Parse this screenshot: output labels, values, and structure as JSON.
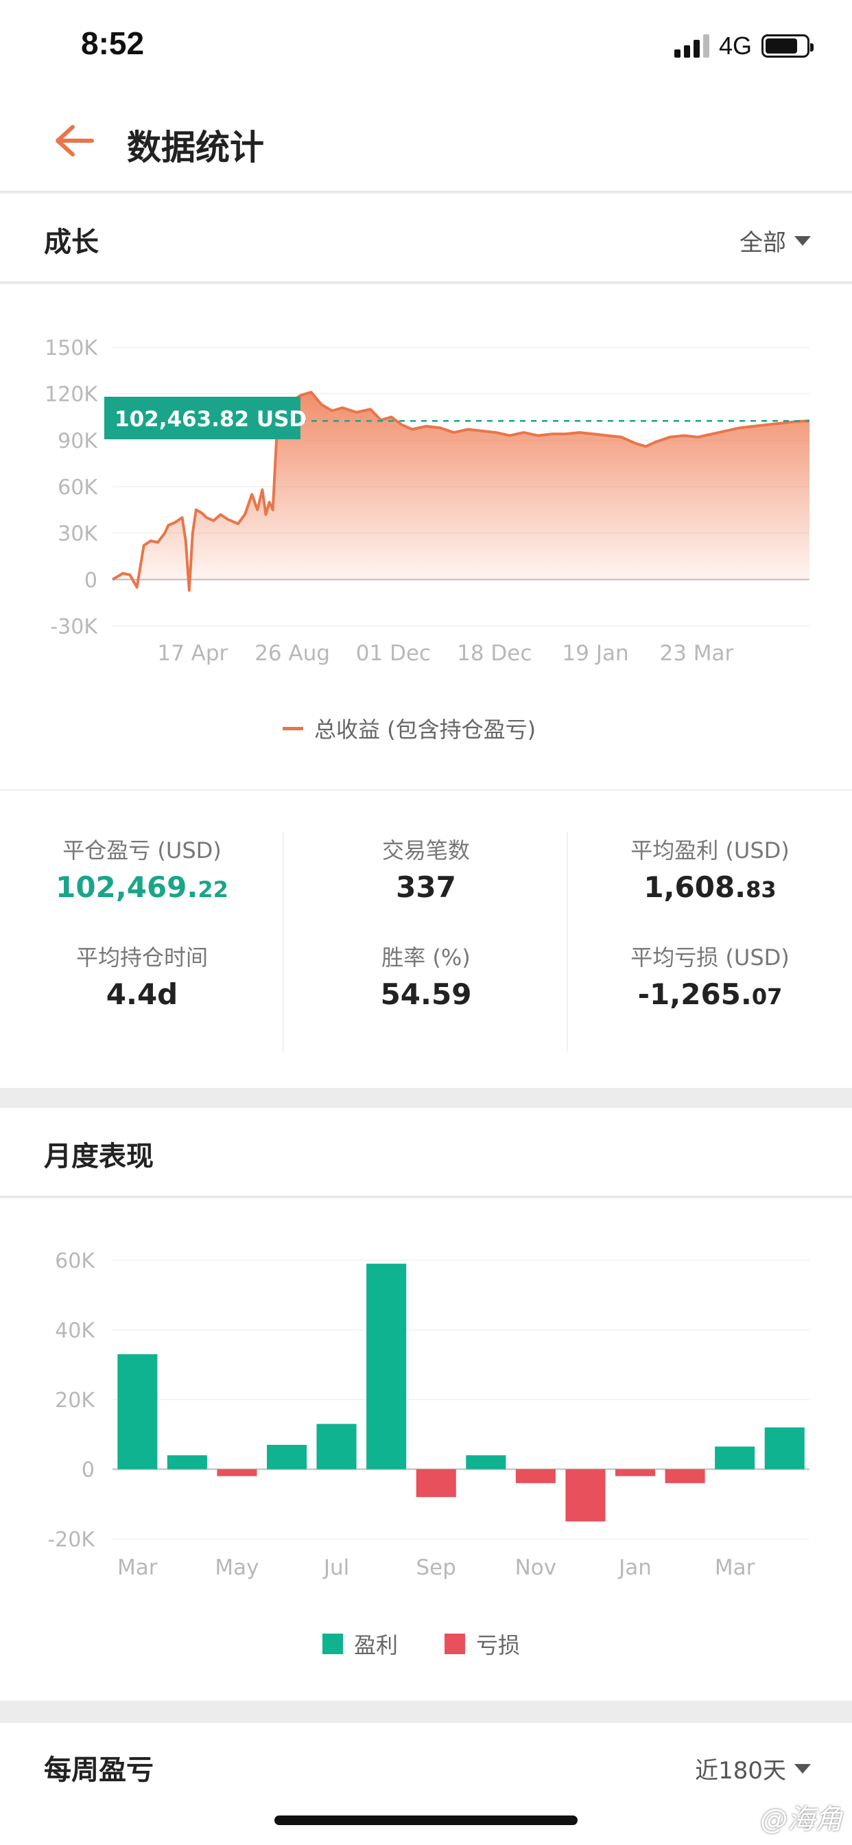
{
  "status": {
    "time": "8:52",
    "network": "4G"
  },
  "header": {
    "title": "数据统计"
  },
  "growth": {
    "title": "成长",
    "filter": "全部",
    "highlight": "102,463.82 USD",
    "legend": "总收益 (包含持仓盈亏)",
    "y_ticks": [
      "150K",
      "120K",
      "90K",
      "60K",
      "30K",
      "0",
      "-30K"
    ],
    "x_ticks": [
      "17 Apr",
      "26 Aug",
      "01 Dec",
      "18 Dec",
      "19 Jan",
      "23 Mar"
    ]
  },
  "stats": {
    "closed_pnl_label": "平仓盈亏 (USD)",
    "closed_pnl_int": "102,469.",
    "closed_pnl_dec": "22",
    "trades_label": "交易笔数",
    "trades_value": "337",
    "avg_profit_label": "平均盈利 (USD)",
    "avg_profit_int": "1,608.",
    "avg_profit_dec": "83",
    "avg_hold_label": "平均持仓时间",
    "avg_hold_value": "4.4d",
    "winrate_label": "胜率 (%)",
    "winrate_value": "54.59",
    "avg_loss_label": "平均亏损 (USD)",
    "avg_loss_int": "-1,265.",
    "avg_loss_dec": "07"
  },
  "monthly": {
    "title": "月度表现",
    "y_ticks": [
      "60K",
      "40K",
      "20K",
      "0",
      "-20K"
    ],
    "x_ticks": [
      "Mar",
      "May",
      "Jul",
      "Sep",
      "Nov",
      "Jan",
      "Mar"
    ],
    "legend_profit": "盈利",
    "legend_loss": "亏损"
  },
  "weekly": {
    "title": "每周盈亏",
    "filter": "近180天"
  },
  "watermark": "@海角",
  "colors": {
    "accent": "#e8764a",
    "profit": "#0fb390",
    "loss": "#e8505b",
    "highlight_bg": "#1aa58a"
  },
  "chart_data": [
    {
      "type": "area",
      "legend": "总收益 (包含持仓盈亏)",
      "ylim": [
        -30000,
        150000
      ],
      "grid": true,
      "legend_position": "bottom",
      "x_tick_labels": [
        "17 Apr",
        "26 Aug",
        "01 Dec",
        "18 Dec",
        "19 Jan",
        "23 Mar"
      ],
      "x_index_range": [
        0,
        100
      ],
      "x_tick_positions": [
        11.5,
        25.8,
        40.3,
        54.8,
        69.3,
        83.8
      ],
      "series": [
        {
          "x": [
            0,
            1.5,
            2.5,
            3.5,
            4.5,
            5.5,
            6.5,
            7.5,
            8,
            9,
            10,
            10.5,
            11,
            11.5,
            12,
            12.8,
            13.5,
            14.5,
            15.5,
            16.5,
            18,
            19,
            20,
            20.8,
            21.5,
            22,
            22.5,
            23,
            23.7,
            24.3,
            25,
            26,
            27,
            28.5,
            30,
            31.5,
            33,
            35,
            37,
            38.5,
            40,
            41.5,
            43,
            45,
            47,
            49,
            51,
            53,
            55,
            57,
            59,
            61,
            63,
            65,
            67,
            69,
            71,
            73,
            75,
            76.5,
            78,
            80,
            82,
            84,
            86,
            88,
            90,
            92,
            94,
            96,
            98,
            100
          ],
          "y": [
            0,
            4000,
            3000,
            -5000,
            22000,
            25000,
            24000,
            30000,
            35000,
            37000,
            40000,
            25000,
            -7000,
            30000,
            45000,
            43000,
            40000,
            38000,
            42000,
            39000,
            36000,
            42000,
            55000,
            45000,
            58000,
            42000,
            50000,
            45000,
            105000,
            113000,
            114000,
            116000,
            119000,
            121000,
            113000,
            109000,
            111000,
            108000,
            110000,
            103000,
            105000,
            100000,
            97000,
            99000,
            98000,
            95000,
            97000,
            96000,
            95000,
            93000,
            95000,
            93000,
            94000,
            94000,
            95000,
            94000,
            93000,
            92000,
            88000,
            86000,
            89000,
            92000,
            93000,
            92000,
            94000,
            96000,
            98000,
            99000,
            100000,
            101000,
            102000,
            102500
          ]
        }
      ],
      "reference_value": 102463.82
    },
    {
      "type": "bar",
      "ylim": [
        -20000,
        60000
      ],
      "grid": true,
      "legend_position": "bottom",
      "legend": [
        "盈利",
        "亏损"
      ],
      "x_tick_labels": [
        "Mar",
        "May",
        "Jul",
        "Sep",
        "Nov",
        "Jan",
        "Mar"
      ],
      "values": [
        33000,
        4000,
        -2000,
        7000,
        13000,
        59000,
        -8000,
        4000,
        -4000,
        -15000,
        -2000,
        -4000,
        6500,
        12000
      ]
    }
  ]
}
